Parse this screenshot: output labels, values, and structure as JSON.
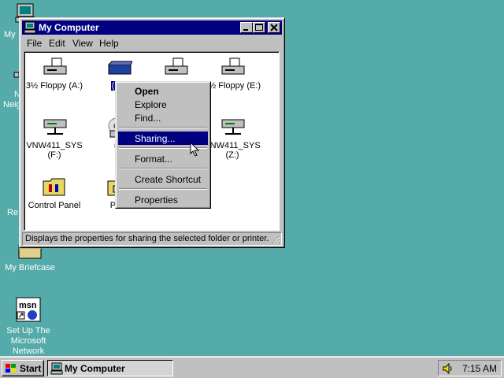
{
  "desktop": {
    "icons": [
      {
        "label": "My",
        "icon": "my-computer-icon"
      },
      {
        "label": "N",
        "label2": "Neig",
        "icon": "network-neighborhood-icon"
      },
      {
        "label": "Re",
        "icon": "recycle-bin-icon"
      },
      {
        "label": "My Briefcase",
        "icon": "briefcase-icon"
      },
      {
        "label": "Set Up The",
        "label2": "Microsoft",
        "label3": "Network",
        "icon": "msn-icon"
      }
    ]
  },
  "window": {
    "title": "My Computer",
    "controls": [
      "minimize",
      "maximize",
      "close"
    ],
    "menu": [
      "File",
      "Edit",
      "View",
      "Help"
    ],
    "items": [
      {
        "label": "3½ Floppy (A:)",
        "icon": "floppy-drive-icon"
      },
      {
        "label": "(C:)",
        "icon": "hard-drive-icon",
        "selected": true
      },
      {
        "label": "",
        "icon": "floppy-drive-icon"
      },
      {
        "label": "3½ Floppy (E:)",
        "icon": "floppy-drive-icon"
      },
      {
        "label": "VNW411_SYS",
        "label2": "(F:)",
        "icon": "network-drive-icon"
      },
      {
        "label": "(G",
        "icon": "cd-drive-icon"
      },
      {
        "label": "VNW411_SYS",
        "label2": "(Z:)",
        "icon": "network-drive-icon"
      },
      {
        "label": "Control Panel",
        "icon": "control-panel-icon"
      },
      {
        "label": "Print",
        "icon": "printers-folder-icon"
      }
    ],
    "status": "Displays the properties for sharing the selected folder or printer."
  },
  "context_menu": {
    "items": [
      {
        "label": "Open",
        "bold": true
      },
      {
        "label": "Explore"
      },
      {
        "label": "Find..."
      },
      {
        "label": "Sharing...",
        "highlighted": true
      },
      {
        "label": "Format..."
      },
      {
        "label": "Create Shortcut"
      },
      {
        "label": "Properties"
      }
    ]
  },
  "taskbar": {
    "start_label": "Start",
    "task_label": "My Computer",
    "clock": "7:15 AM"
  },
  "colors": {
    "desktop": "#55aaaa",
    "titlebar": "#000080",
    "face": "#c0c0c0"
  }
}
